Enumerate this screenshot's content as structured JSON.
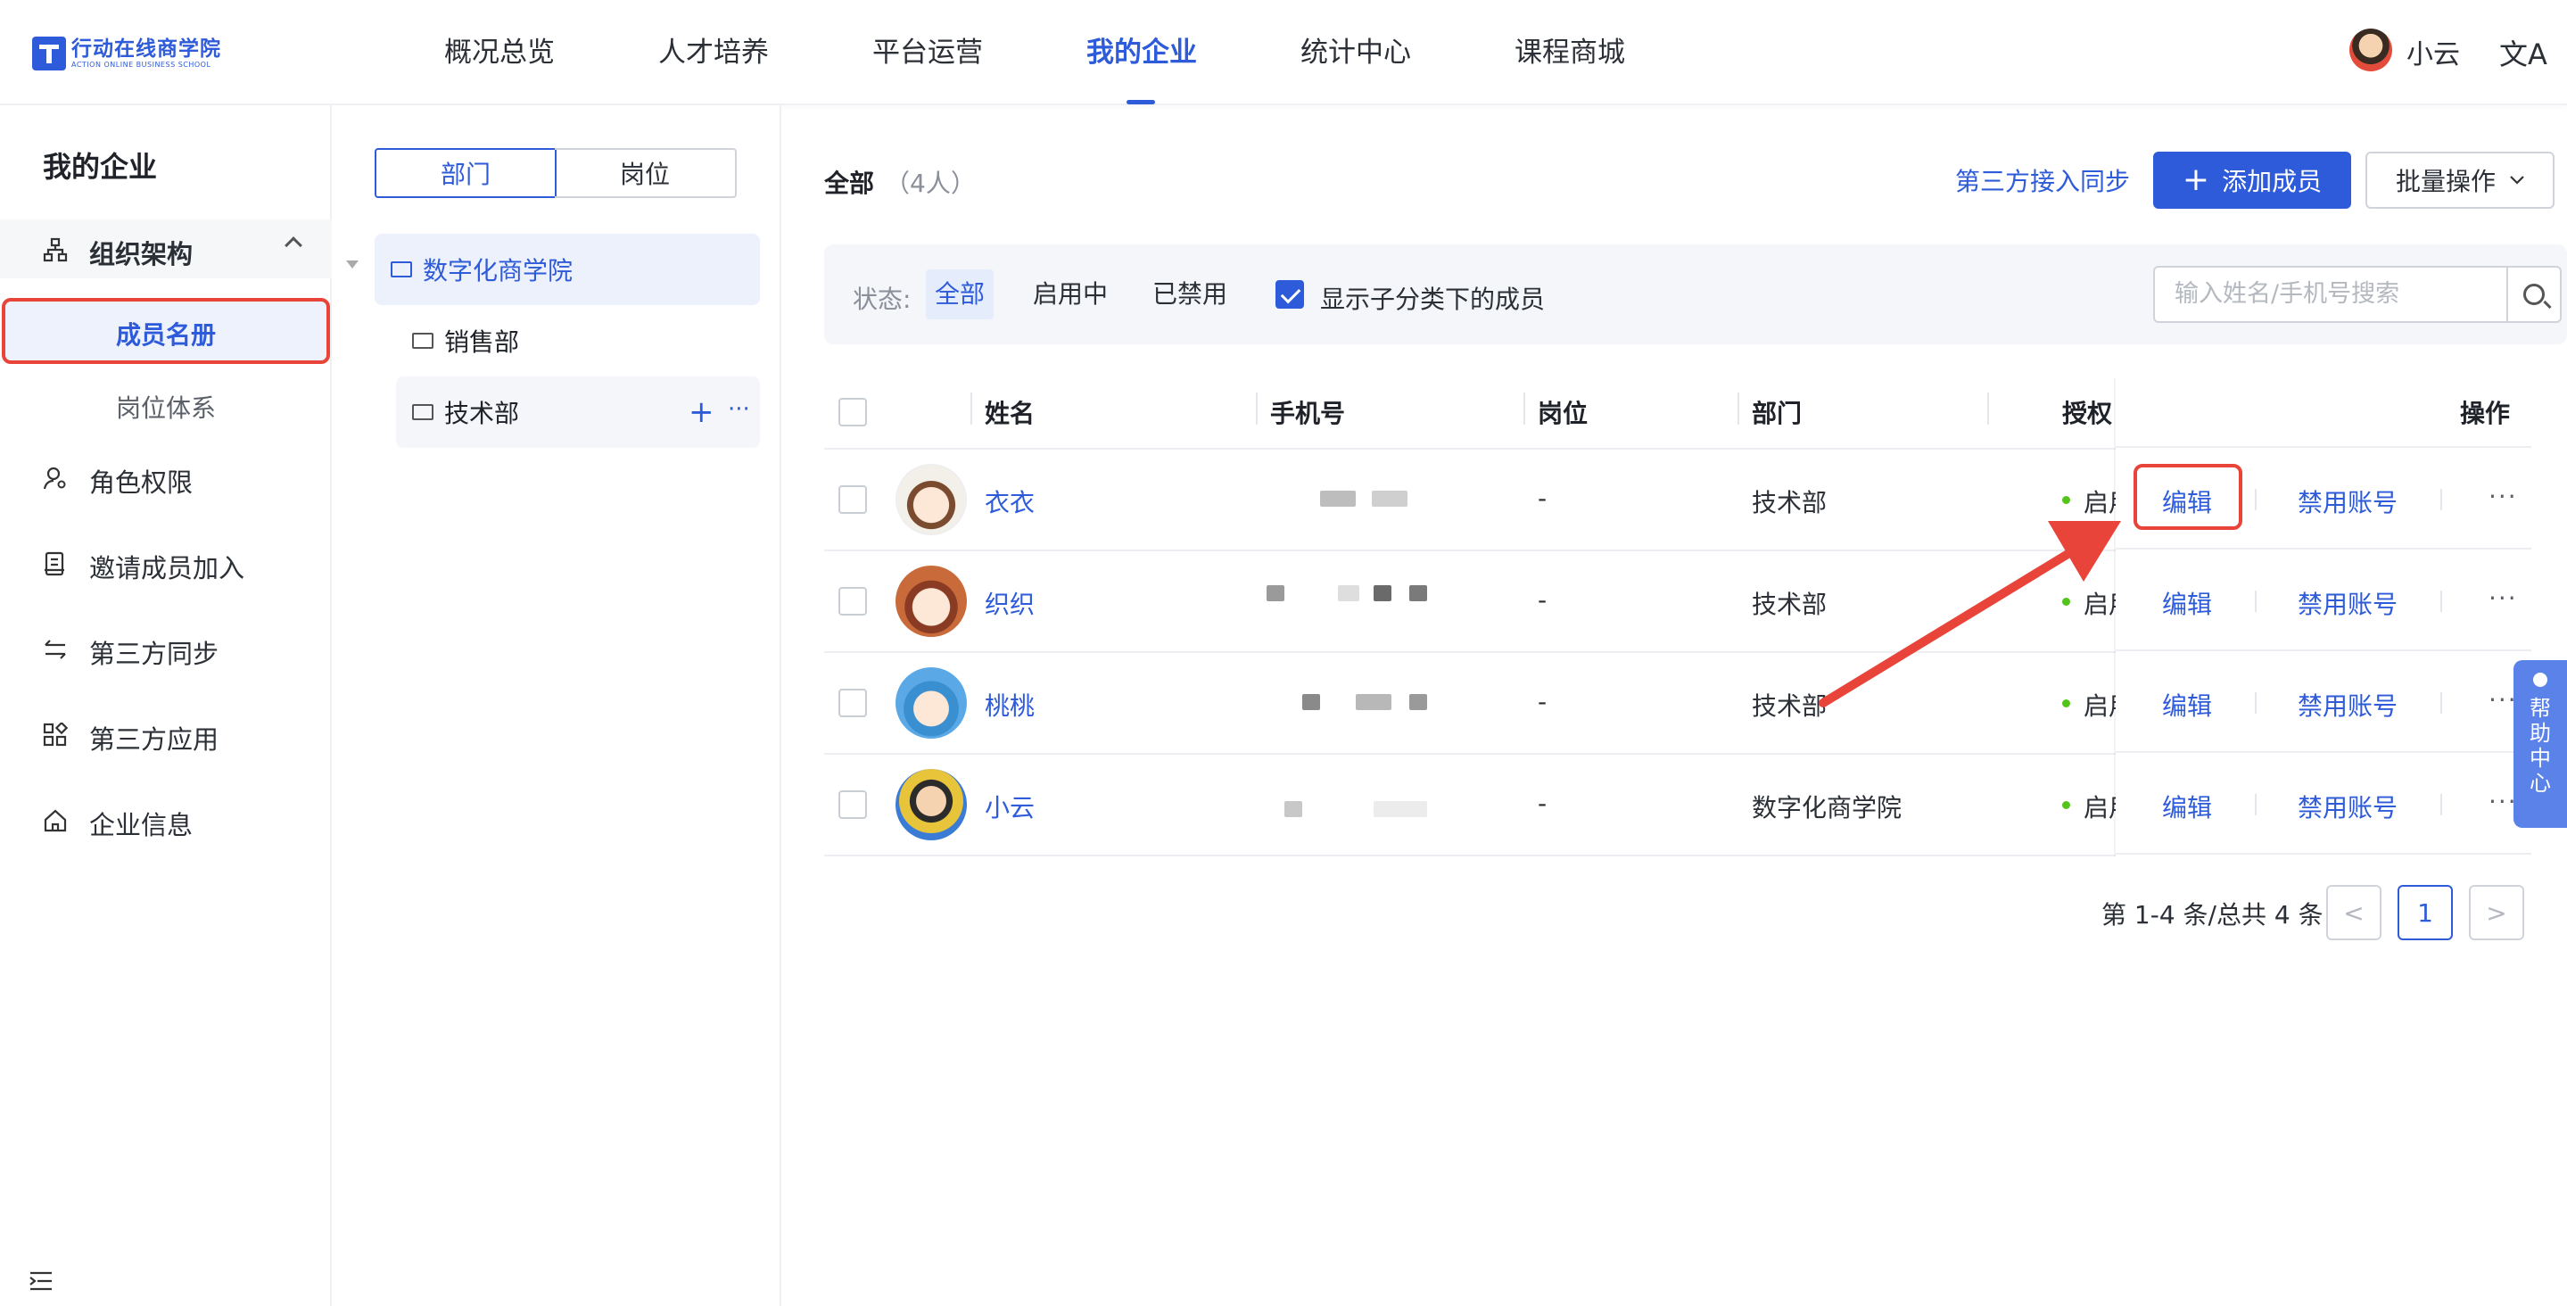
{
  "header": {
    "logo_cn": "行动在线商学院",
    "logo_en": "ACTION ONLINE BUSINESS SCHOOL",
    "nav": [
      "概况总览",
      "人才培养",
      "平台运营",
      "我的企业",
      "统计中心",
      "课程商城"
    ],
    "active_nav": "我的企业",
    "user_name": "小云",
    "lang_icon": "文A"
  },
  "sidebar": {
    "title": "我的企业",
    "group_label": "组织架构",
    "sub_items": [
      "成员名册",
      "岗位体系"
    ],
    "items": [
      "角色权限",
      "邀请成员加入",
      "第三方同步",
      "第三方应用",
      "企业信息"
    ],
    "icons": [
      "org-icon",
      "role-icon",
      "invite-icon",
      "sync-icon",
      "apps-icon",
      "home-icon"
    ]
  },
  "dept_panel": {
    "tabs": [
      "部门",
      "岗位"
    ],
    "tree": [
      "数字化商学院",
      "销售部",
      "技术部"
    ],
    "add_symbol": "+",
    "more_symbol": "···"
  },
  "main": {
    "title": "全部",
    "count": "（4人）",
    "sync_link": "第三方接入同步",
    "add_button": "添加成员",
    "add_plus": "+",
    "batch_button": "批量操作",
    "filter_label": "状态:",
    "filter_options": [
      "全部",
      "启用中",
      "已禁用"
    ],
    "show_sub_label": "显示子分类下的成员",
    "search_placeholder": "输入姓名/手机号搜索"
  },
  "table": {
    "columns": [
      "姓名",
      "手机号",
      "岗位",
      "部门",
      "授权",
      "操作"
    ],
    "rows": [
      {
        "name": "衣衣",
        "post": "-",
        "dept": "技术部",
        "status": "启用中"
      },
      {
        "name": "织织",
        "post": "-",
        "dept": "技术部",
        "status": "启用中"
      },
      {
        "name": "桃桃",
        "post": "-",
        "dept": "技术部",
        "status": "启用中"
      },
      {
        "name": "小云",
        "post": "-",
        "dept": "数字化商学院",
        "status": "启用中"
      }
    ],
    "edit_label": "编辑",
    "disable_label": "禁用账号",
    "more_label": "···"
  },
  "pager": {
    "summary": "第 1-4 条/总共 4 条",
    "current": "1",
    "prev": "<",
    "next": ">"
  },
  "help": {
    "label": [
      "帮",
      "助",
      "中",
      "心"
    ]
  },
  "colors": {
    "accent": "#2e5bd9",
    "annotation_red": "#e8443a",
    "status_green": "#52c41a"
  }
}
